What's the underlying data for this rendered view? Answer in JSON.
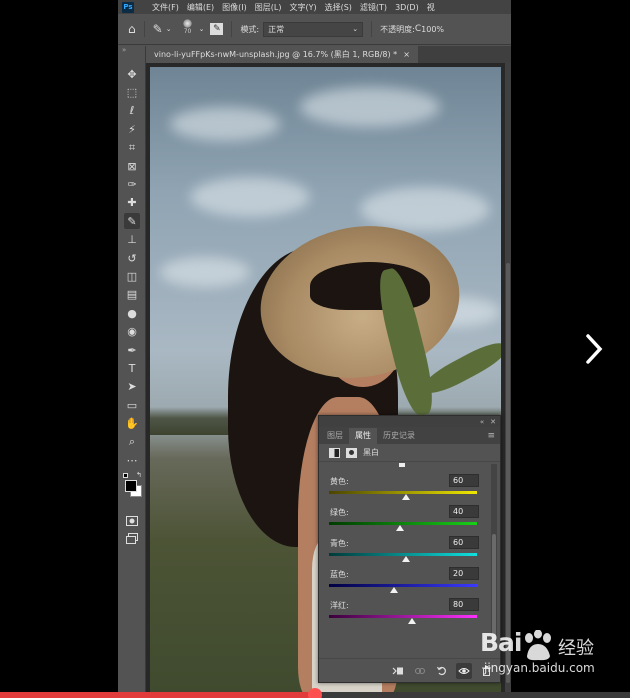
{
  "app": {
    "logo": "Ps",
    "menu": [
      "文件(F)",
      "编辑(E)",
      "图像(I)",
      "图层(L)",
      "文字(Y)",
      "选择(S)",
      "滤镜(T)",
      "3D(D)",
      "视"
    ]
  },
  "options": {
    "brush_size": "70",
    "mode_label": "模式:",
    "mode_value": "正常",
    "opacity_label": "不透明度:",
    "opacity_value": "100%"
  },
  "document": {
    "tab_title": "vino-li-yuFFpKs-nwM-unsplash.jpg @ 16.7% (黑白 1, RGB/8) *",
    "close": "×"
  },
  "toolbar": {
    "collapse": "»",
    "tools": [
      "move-tool",
      "marquee-tool",
      "lasso-tool",
      "magic-wand-tool",
      "crop-tool",
      "frame-tool",
      "eyedropper-tool",
      "healing-tool",
      "brush-tool",
      "stamp-tool",
      "history-brush-tool",
      "eraser-tool",
      "gradient-tool",
      "blur-tool",
      "dodge-tool",
      "pen-tool",
      "type-tool",
      "path-select-tool",
      "shape-tool",
      "hand-tool",
      "zoom-tool",
      "more-tools"
    ],
    "active_tool": "brush-tool",
    "type_glyph": "T"
  },
  "panel": {
    "collapse": "«",
    "close": "✕",
    "tabs": [
      "图层",
      "属性",
      "历史记录"
    ],
    "active_tab": "属性",
    "menu_icon": "≡",
    "title": "黑白",
    "sliders": [
      {
        "label": "黄色:",
        "value": "60",
        "fraction": 0.52,
        "gradient": [
          "#4a4400",
          "#f0e800"
        ]
      },
      {
        "label": "绿色:",
        "value": "40",
        "fraction": 0.48,
        "gradient": [
          "#003a00",
          "#18d018"
        ]
      },
      {
        "label": "青色:",
        "value": "60",
        "fraction": 0.52,
        "gradient": [
          "#003a3a",
          "#10e0e0"
        ]
      },
      {
        "label": "蓝色:",
        "value": "20",
        "fraction": 0.44,
        "gradient": [
          "#000040",
          "#3a3aff"
        ]
      },
      {
        "label": "洋红:",
        "value": "80",
        "fraction": 0.56,
        "gradient": [
          "#3a003a",
          "#ff30ff"
        ]
      }
    ]
  },
  "player": {
    "progress": 0.5
  },
  "watermark": {
    "logo": "Bai",
    "logo_suffix": "",
    "cn": "经验",
    "url": "jingyan.baidu.com"
  },
  "colors": {
    "progress": "#e23b3b",
    "ui_bg": "#535353"
  }
}
